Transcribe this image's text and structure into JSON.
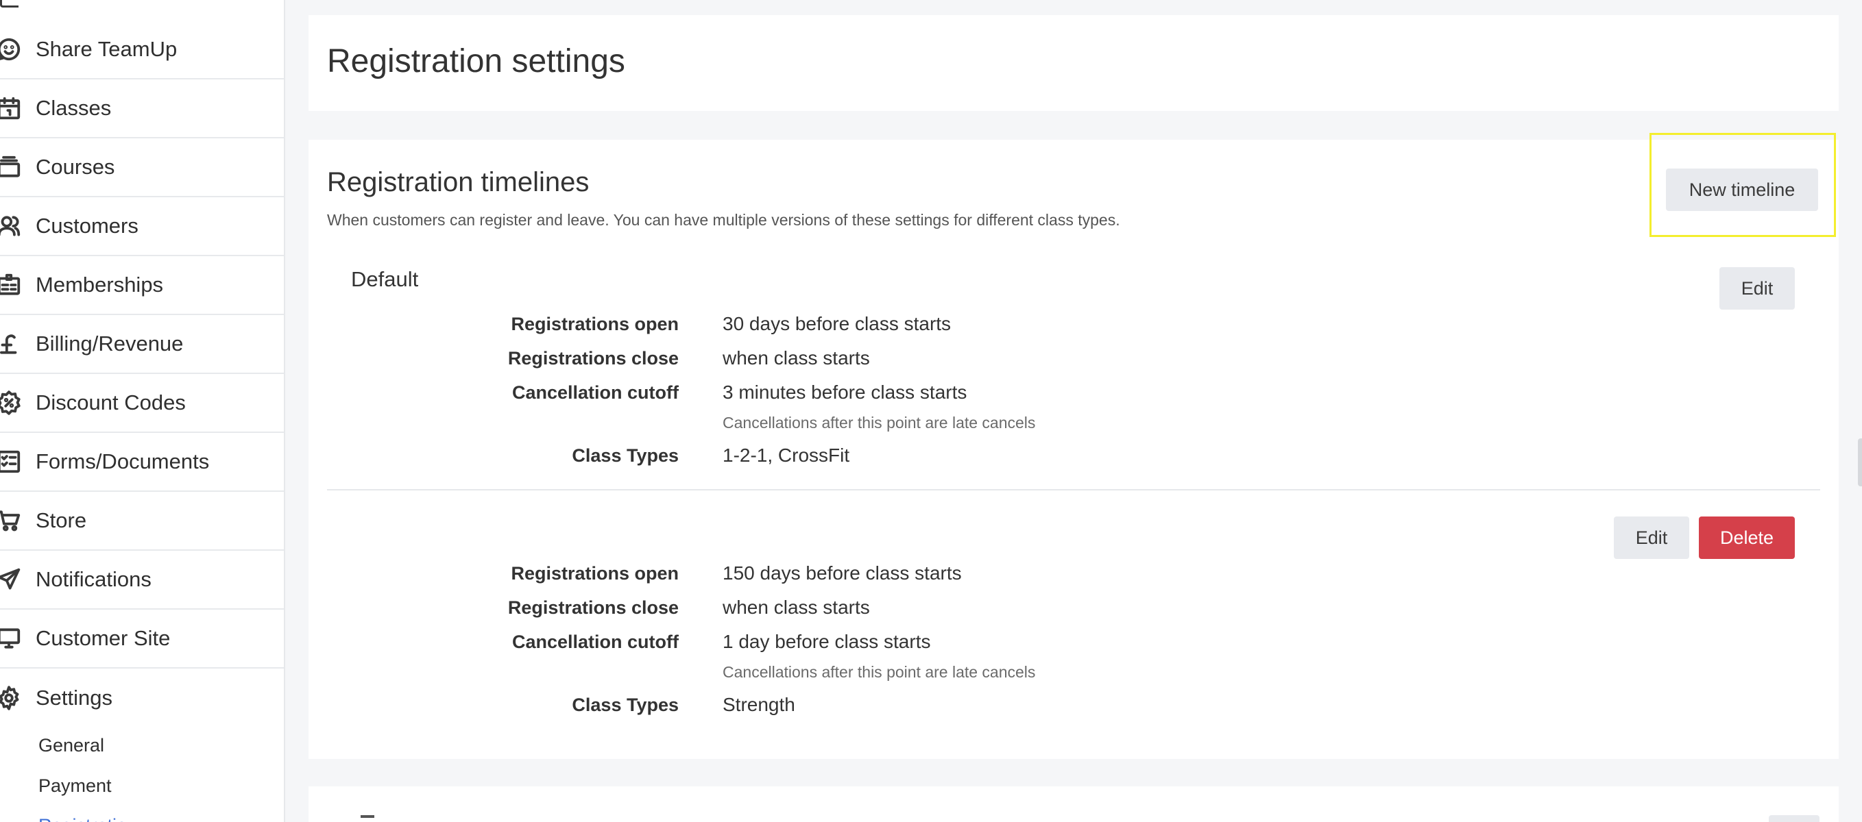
{
  "sidebar": {
    "items": [
      {
        "label": "Share TeamUp",
        "icon": "share-smile-icon"
      },
      {
        "label": "Classes",
        "icon": "calendar-icon"
      },
      {
        "label": "Courses",
        "icon": "stack-icon"
      },
      {
        "label": "Customers",
        "icon": "users-icon"
      },
      {
        "label": "Memberships",
        "icon": "id-card-icon"
      },
      {
        "label": "Billing/Revenue",
        "icon": "pound-icon"
      },
      {
        "label": "Discount Codes",
        "icon": "discount-badge-icon"
      },
      {
        "label": "Forms/Documents",
        "icon": "checklist-icon"
      },
      {
        "label": "Store",
        "icon": "cart-icon"
      },
      {
        "label": "Notifications",
        "icon": "send-icon"
      },
      {
        "label": "Customer Site",
        "icon": "monitor-icon"
      },
      {
        "label": "Settings",
        "icon": "gear-icon"
      }
    ],
    "sub_items": [
      {
        "label": "General"
      },
      {
        "label": "Payment"
      },
      {
        "label": "Registratio"
      }
    ]
  },
  "page": {
    "title": "Registration settings"
  },
  "timelines_section": {
    "title": "Registration timelines",
    "description": "When customers can register and leave. You can have multiple versions of these settings for different class types.",
    "new_button_label": "New timeline",
    "timelines": [
      {
        "name": "Default",
        "edit_label": "Edit",
        "rows": {
          "open_label": "Registrations open",
          "open_value": "30 days before class starts",
          "close_label": "Registrations close",
          "close_value": "when class starts",
          "cutoff_label": "Cancellation cutoff",
          "cutoff_value": "3 minutes before class starts",
          "cutoff_note": "Cancellations after this point are late cancels",
          "types_label": "Class Types",
          "types_value": "1-2-1, CrossFit"
        }
      },
      {
        "name": "",
        "edit_label": "Edit",
        "delete_label": "Delete",
        "rows": {
          "open_label": "Registrations open",
          "open_value": "150 days before class starts",
          "close_label": "Registrations close",
          "close_value": "when class starts",
          "cutoff_label": "Cancellation cutoff",
          "cutoff_value": "1 day before class starts",
          "cutoff_note": "Cancellations after this point are late cancels",
          "types_label": "Class Types",
          "types_value": "Strength"
        }
      }
    ]
  },
  "colors": {
    "delete_button": "#d5404a",
    "highlight_outline": "#f4ee2e",
    "active_sub_item": "#3d6fd6"
  }
}
